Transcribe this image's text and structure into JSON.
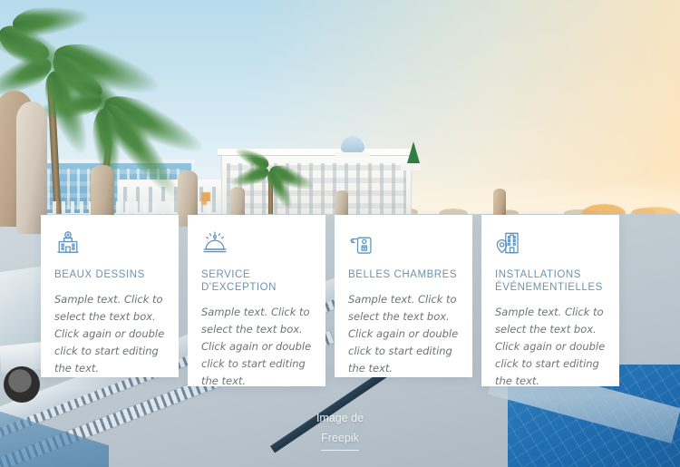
{
  "page": {
    "title": "Hotel services — four feature cards over pool photo",
    "background_description": "Resort pool deck at dusk with palm trees, closed beige parasols, white and blue hotel buildings, blue pool water at lower right"
  },
  "colors": {
    "card_background": "#ffffff",
    "title_text": "#6d93b0",
    "body_text": "#6e7377",
    "icon_stroke": "#5b93bd",
    "pool_blue": "#2573b4",
    "sky_blue": "#b8dbeb",
    "credit_text": "#eef3f6"
  },
  "cards": [
    {
      "icon": "hotel-building-icon",
      "title": "BEAUX DESSINS",
      "body": "Sample text. Click to select the text box. Click again or double click to start editing the text."
    },
    {
      "icon": "service-bell-icon",
      "title": "SERVICE D'EXCEPTION",
      "body": "Sample text. Click to select the text box. Click again or double click to start editing the text."
    },
    {
      "icon": "door-hanger-key-icon",
      "title": "BELLES CHAMBRES",
      "body": "Sample text. Click to select the text box. Click again or double click to start editing the text."
    },
    {
      "icon": "hotel-location-pin-icon",
      "title": "INSTALLATIONS ÉVÉNEMENTIELLES",
      "body": "Sample text. Click to select the text box. Click again or double click to start editing the text."
    }
  ],
  "credit": {
    "line1": "Image de",
    "line2": "Freepik"
  }
}
